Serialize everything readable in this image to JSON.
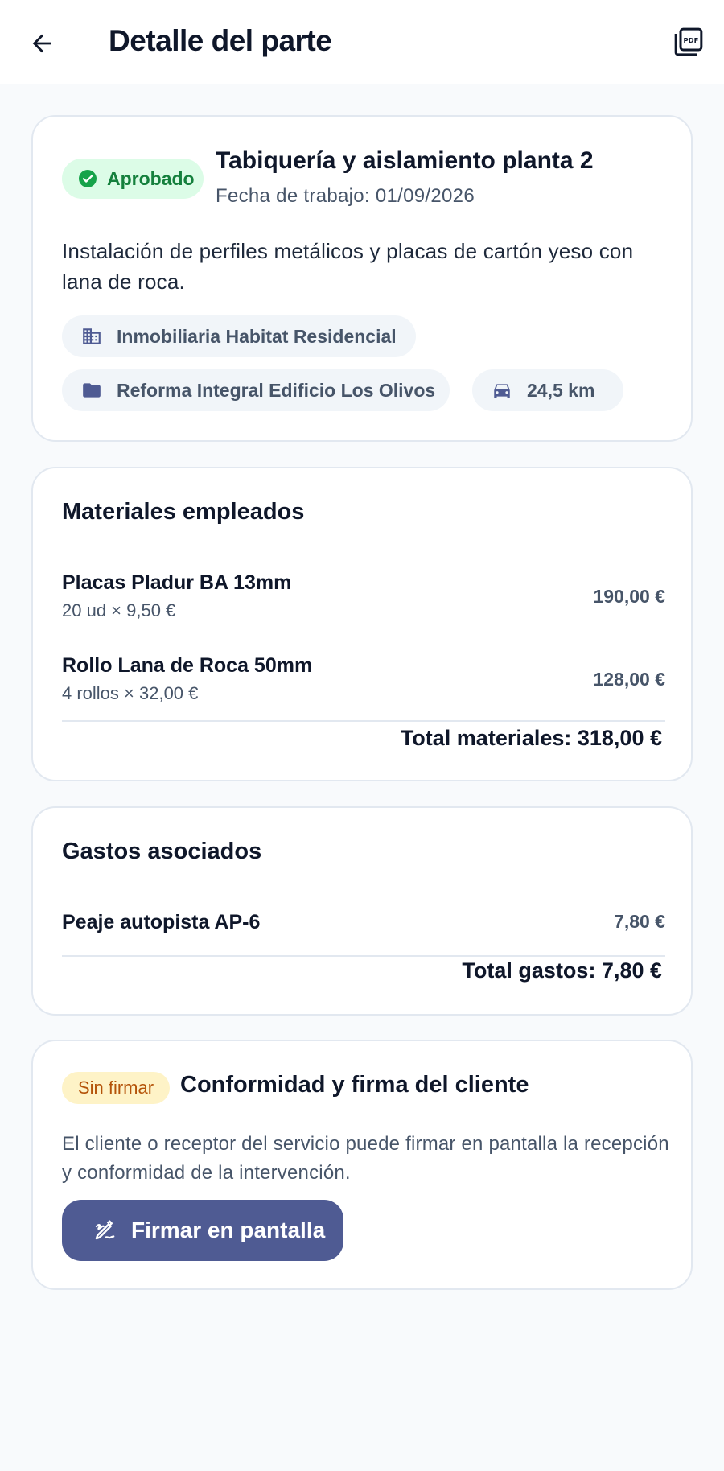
{
  "header": {
    "title": "Detalle del parte",
    "back_icon": "arrow-left-icon",
    "pdf_icon": "pdf-icon"
  },
  "summary": {
    "status": "Aprobado",
    "title": "Tabiquería y aislamiento planta 2",
    "date": "Fecha de trabajo: 01/09/2026",
    "description": "Instalación de perfiles metálicos y placas de cartón yeso con lana de roca.",
    "client": "Inmobiliaria Habitat Residencial",
    "project": "Reforma Integral Edificio Los Olivos",
    "distance": "24,5 km"
  },
  "materials": {
    "title": "Materiales empleados",
    "items": [
      {
        "name": "Placas Pladur BA 13mm",
        "qty": "20 ud × 9,50 €",
        "price": "190,00 €"
      },
      {
        "name": "Rollo Lana de Roca 50mm",
        "qty": "4 rollos × 32,00 €",
        "price": "128,00 €"
      }
    ],
    "total": "Total materiales: 318,00 €"
  },
  "expenses": {
    "title": "Gastos asociados",
    "items": [
      {
        "name": "Peaje autopista AP-6",
        "price": "7,80 €"
      }
    ],
    "total": "Total gastos: 7,80 €"
  },
  "signature": {
    "status": "Sin firmar",
    "title": "Conformidad y firma del cliente",
    "description": "El cliente o receptor del servicio puede firmar en pantalla la recepción y conformidad de la intervención.",
    "button_label": "Firmar en pantalla"
  },
  "colors": {
    "primary": "#4f5b93",
    "approved_bg": "#dcfce7",
    "approved_text": "#15803d",
    "unsigned_bg": "#fef3c7",
    "unsigned_text": "#b45309"
  }
}
